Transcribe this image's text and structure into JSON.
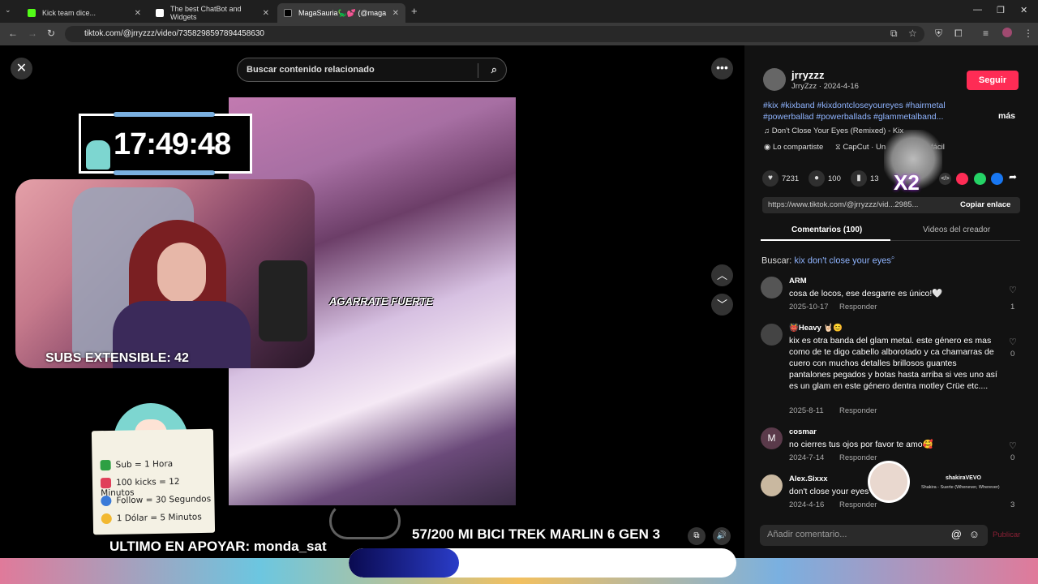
{
  "browser": {
    "tabs": [
      {
        "label": "Kick team dice...",
        "color": "#53fc18"
      },
      {
        "label": "The best ChatBot and Widgets",
        "color": "#ffffff"
      },
      {
        "label": "MagaSauria🦕💕 (@maga",
        "color": "#000000"
      }
    ],
    "url": "tiktok.com/@jrryzzz/video/7358298597894458630"
  },
  "search": {
    "placeholder": "Buscar contenido relacionado"
  },
  "overlay": {
    "clock": "17:49:48",
    "subs": "SUBS EXTENSIBLE: 42",
    "caption": "AGARRATE FUERTE",
    "rules": [
      {
        "text": "Sub = 1 Hora",
        "color": "#2ea043"
      },
      {
        "text": "100 kicks = 12 Minutos",
        "color": "#e0405a"
      },
      {
        "text": "Follow = 30 Segundos",
        "color": "#3a7ad8"
      },
      {
        "text": "1 Dólar = 5 Minutos",
        "color": "#f2b830"
      }
    ],
    "ultimo": "ULTIMO EN APOYAR: monda_sat",
    "goal": "57/200 MI BICI TREK MARLIN 6 GEN 3",
    "goal_progress": 0.285
  },
  "sidebar": {
    "username": "jrryzzz",
    "subline": "JrryZzz · 2024-4-16",
    "follow": "Seguir",
    "tags": "#kix #kixband #kixdontcloseyoureyes #hairmetal #powerballad #powerballads #glammetalband...",
    "more": "más",
    "music": "♫  Don't Close Your Eyes (Remixed) - Kix",
    "shared": "Lo compartiste",
    "capcut": "CapCut · Un",
    "facil": "fácil",
    "likes": "7231",
    "comments": "100",
    "saves": "13",
    "link": "https://www.tiktok.com/@jrryzzz/vid...2985...",
    "copy": "Copiar enlace",
    "tab_comments": "Comentarios (100)",
    "tab_videos": "Videos del creador",
    "buscar_label": "Buscar:",
    "buscar_query": "kix don't close your eyes",
    "comments_list": [
      {
        "name": "ARM",
        "text": "cosa de locos, ese desgarre es único!🤍",
        "date": "2025-10-17",
        "reply": "Responder",
        "count": "1"
      },
      {
        "name": "👹Heavy 🤘🏻😊",
        "text": "kix es otra banda del glam metal. este género es mas como de te digo cabello alborotado y ca chamarras de cuero con muchos detalles brillosos guantes pantalones pegados y botas hasta arriba si ves uno así es un glam en este género dentra motley Crüe etc....",
        "date": "2025-8-11",
        "reply": "Responder",
        "count": "0"
      },
      {
        "name": "cosmar",
        "text": "no cierres tus ojos por favor te amo🥰",
        "date": "2024-7-14",
        "reply": "Responder",
        "count": "0",
        "initial": "M"
      },
      {
        "name": "Alex.Sixxx",
        "text": "don't close your eyes",
        "date": "2024-4-16",
        "reply": "Responder",
        "count": "3"
      }
    ],
    "add_comment": "Añadir comentario...",
    "publish": "Publicar",
    "shakira_title": "shakiraVEVO",
    "shakira_sub": "Shakira - Suerte (Whenever, Wherever)"
  }
}
